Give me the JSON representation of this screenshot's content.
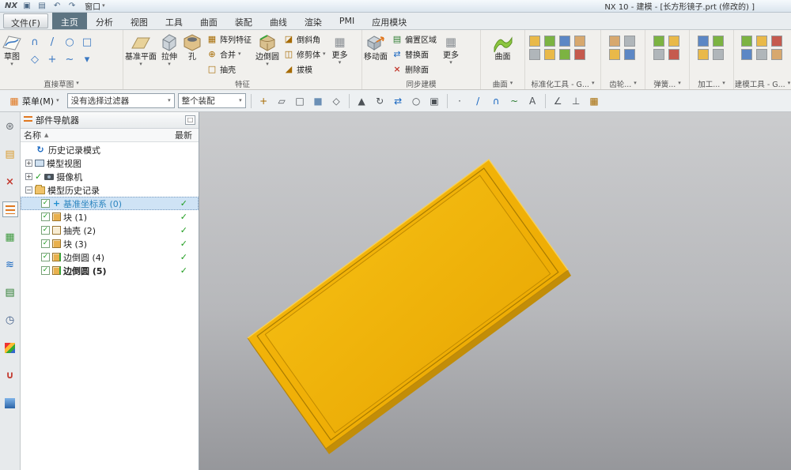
{
  "titlebar": {
    "logo": "NX",
    "window_menu": "窗口",
    "title": "NX 10 - 建模 - [长方形镜子.prt (修改的) ]"
  },
  "tabs": {
    "file": "文件(F)",
    "home": "主页",
    "analysis": "分析",
    "view": "视图",
    "tools": "工具",
    "surface": "曲面",
    "assembly": "装配",
    "curve": "曲线",
    "render": "渲染",
    "pmi": "PMI",
    "app_module": "应用模块"
  },
  "ribbon": {
    "sketch": {
      "button": "草图",
      "group": "直接草图"
    },
    "feature": {
      "group": "特征",
      "datum_plane": "基准平面",
      "extrude": "拉伸",
      "hole": "孔",
      "pattern": "阵列特征",
      "unite": "合并",
      "shell": "抽壳",
      "edge_blend": "边倒圆",
      "chamfer": "倒斜角",
      "trim_body": "修剪体",
      "draft": "拔模",
      "more": "更多"
    },
    "sync": {
      "group": "同步建模",
      "move_face": "移动面",
      "offset_region": "偏置区域",
      "replace_face": "替换面",
      "delete_face": "删除面",
      "more": "更多"
    },
    "surface_group": {
      "button": "曲面",
      "group": "曲面"
    },
    "right_groups": {
      "standard_tools": "标准化工具 - G...",
      "gear": "齿轮...",
      "spring": "弹簧...",
      "machining": "加工...",
      "modeling_tools": "建模工具 - G..."
    }
  },
  "selection_bar": {
    "menu": "菜单(M)",
    "filter": "没有选择过滤器",
    "scope": "整个装配",
    "icon_glyphs": [
      "+",
      "▱",
      "□",
      "■",
      "◇",
      "▲",
      "↻",
      "⇄",
      "○",
      "▣",
      "·",
      "/",
      "∩",
      "~",
      "A",
      "∠",
      "⊥",
      "▦"
    ]
  },
  "navigator": {
    "title": "部件导航器",
    "col_name": "名称",
    "col_latest": "最新",
    "rows": {
      "history_mode": "历史记录模式",
      "model_views": "模型视图",
      "cameras": "摄像机",
      "model_history": "模型历史记录",
      "f0": "基准坐标系 (0)",
      "f1": "块 (1)",
      "f2": "抽壳 (2)",
      "f3": "块 (3)",
      "f4": "边倒圆 (4)",
      "f5": "边倒圆 (5)"
    },
    "status_check": "✓"
  },
  "icons": {
    "chevron_down": "▾",
    "expand": "+",
    "collapse": "−",
    "sort_asc": "▲",
    "check": "✓",
    "menu_grid": "▦",
    "save": "▣",
    "print": "▤",
    "undo": "↶",
    "redo": "↷",
    "pattern": "▦",
    "unite": "⊕",
    "shell": "□",
    "chamfer": "◪",
    "trim": "◫",
    "draft": "◢",
    "offset": "▤",
    "replace": "⇄",
    "delete": "×",
    "more": "▦",
    "sk_profile": "∩",
    "sk_line": "/",
    "sk_circle": "○",
    "sk_rect": "□",
    "sk_polygon": "◇",
    "sk_point": "+",
    "sk_spline": "~",
    "sk_more": "▾",
    "rb_gear": "⊛",
    "rb_tree": "▤",
    "rb_cross": "×",
    "rb_stack": "▦",
    "rb_wave": "≋",
    "rb_doc": "▤",
    "rb_clock": "◷",
    "rb_magnet": "∪",
    "history_arrow": "↻",
    "undock": "□"
  },
  "colors": {
    "part_yellow": "#f2b00a",
    "part_dark": "#b5820a",
    "check_green": "#1e9c1e",
    "active_tab": "#5d7482"
  }
}
